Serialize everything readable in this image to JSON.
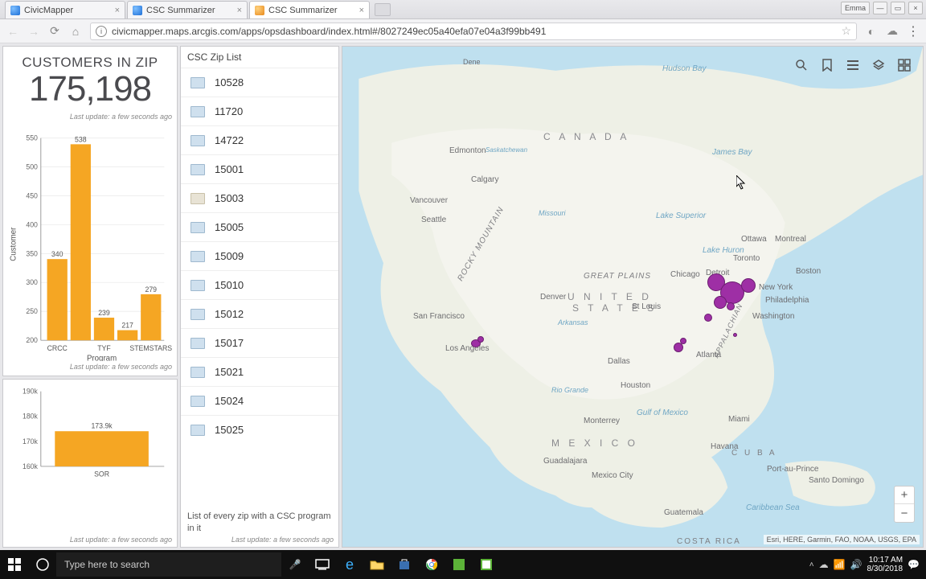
{
  "browser": {
    "tabs": [
      {
        "label": "CivicMapper",
        "active": false,
        "fav": "blue"
      },
      {
        "label": "CSC Summarizer",
        "active": false,
        "fav": "blue"
      },
      {
        "label": "CSC Summarizer",
        "active": true,
        "fav": "orange"
      }
    ],
    "url": "civicmapper.maps.arcgis.com/apps/opsdashboard/index.html#/8027249ec05a40efa07e04a3f99bb491"
  },
  "kpi": {
    "title": "CUSTOMERS IN ZIP",
    "value": "175,198",
    "last_update": "Last update: a few seconds ago"
  },
  "chart_data": [
    {
      "type": "bar",
      "title": "",
      "xlabel": "Program",
      "ylabel": "Customer",
      "ylim": [
        200,
        550
      ],
      "yticks": [
        200,
        250,
        300,
        350,
        400,
        450,
        500,
        550
      ],
      "categories": [
        "CRCC",
        "",
        "TYF",
        "",
        "STEMSTARS"
      ],
      "values": [
        340,
        538,
        239,
        217,
        279
      ],
      "data_labels": [
        "340",
        "538",
        "239",
        "217",
        "279"
      ],
      "color": "#f5a623",
      "last_update": "Last update: a few seconds ago"
    },
    {
      "type": "bar",
      "title": "",
      "xlabel": "",
      "ylabel": "",
      "ylim": [
        160000,
        190000
      ],
      "yticks": [
        160000,
        170000,
        180000,
        190000
      ],
      "ytick_labels": [
        "160k",
        "170k",
        "180k",
        "190k"
      ],
      "categories": [
        "SOR"
      ],
      "values": [
        173900
      ],
      "data_labels": [
        "173.9k"
      ],
      "color": "#f5a623",
      "last_update": "Last update: a few seconds ago"
    }
  ],
  "ziplist": {
    "title": "CSC Zip List",
    "description": "List of every zip with a CSC program in it",
    "last_update": "Last update: a few seconds ago",
    "items": [
      "10528",
      "11720",
      "14722",
      "15001",
      "15003",
      "15005",
      "15009",
      "15010",
      "15012",
      "15017",
      "15021",
      "15024",
      "15025"
    ]
  },
  "map": {
    "credits": "Esri, HERE, Garmin, FAO, NOAA, USGS, EPA",
    "labels": {
      "canada": "C A N A D A",
      "united_states_1": "U N I T E D",
      "united_states_2": "S T A T E S",
      "mexico": "M E X I C O",
      "great_plains": "GREAT PLAINS",
      "rocky": "ROCKY MOUNTAIN",
      "cities": {
        "edmonton": "Edmonton",
        "calgary": "Calgary",
        "vancouver": "Vancouver",
        "seattle": "Seattle",
        "sanfrancisco": "San Francisco",
        "losangeles": "Los Angeles",
        "denver": "Denver",
        "dallas": "Dallas",
        "houston": "Houston",
        "stlouis": "St Louis",
        "chicago": "Chicago",
        "detroit": "Detroit",
        "toronto": "Toronto",
        "ottawa": "Ottawa",
        "montreal": "Montreal",
        "boston": "Boston",
        "newyork": "New York",
        "philadelphia": "Philadelphia",
        "washington": "Washington",
        "atlanta": "Atlanta",
        "miami": "Miami",
        "havana": "Havana",
        "monterrey": "Monterrey",
        "guadalajara": "Guadalajara",
        "mexicocity": "Mexico City",
        "guatemala": "Guatemala",
        "portauprince": "Port-au-Prince",
        "santodomingo": "Santo Domingo",
        "costarica": "COSTA RICA",
        "cuba": "C U B A",
        "missouri": "Missouri",
        "arkansas": "Arkansas",
        "riogrande": "Rio Grande",
        "hudsonbay": "Hudson Bay",
        "jamesbay": "James Bay",
        "lakesuperior": "Lake Superior",
        "lakehuron": "Lake Huron",
        "gulfofmex": "Gulf of Mexico",
        "caribbean": "Caribbean Sea",
        "appalachian": "APPALACHIAN",
        "dene": "Dene",
        "saskatchewan": "Saskatchewan"
      }
    }
  },
  "taskbar": {
    "search_placeholder": "Type here to search",
    "time": "10:17 AM",
    "date": "8/30/2018"
  },
  "window_user": "Emma"
}
